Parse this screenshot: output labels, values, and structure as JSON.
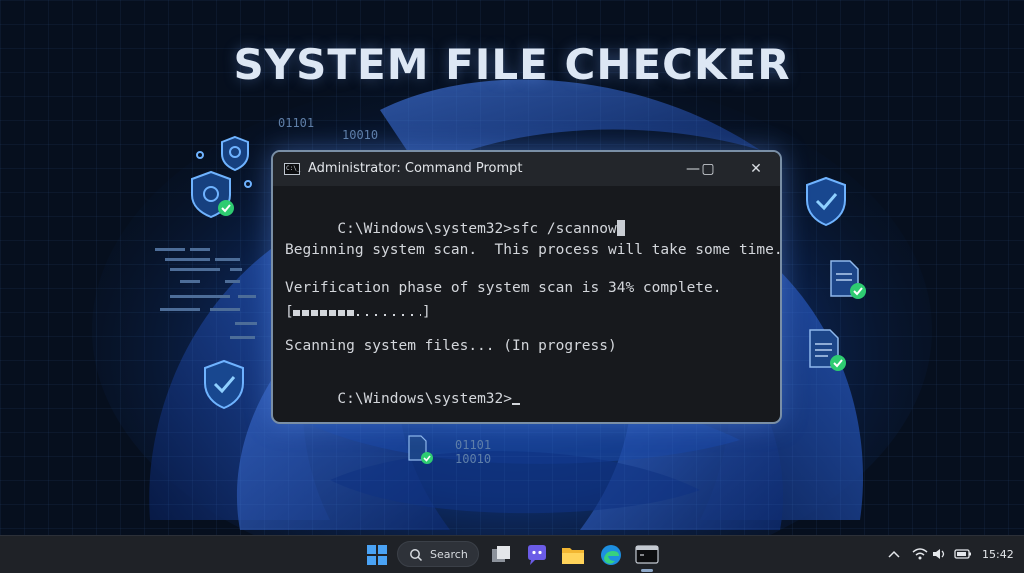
{
  "headline": "SYSTEM FILE CHECKER",
  "background_text": {
    "binary_left_1": "01101",
    "binary_left_2": "10010",
    "binary_bottom_1": "01101",
    "binary_bottom_2": "10010"
  },
  "window": {
    "title": "Administrator: Command Prompt",
    "icon_glyph": "C:\\_",
    "minimize_glyph": "—",
    "maximize_glyph": "▢",
    "close_glyph": "✕"
  },
  "terminal": {
    "command_prompt": "C:\\Windows\\system32>",
    "command": "sfc /scannow",
    "line_begin": "Beginning system scan.  This process will take some time.",
    "line_verification": "Verification phase of system scan is 34% complete.",
    "progress_fraction": 0.34,
    "progress_open": "[",
    "progress_close": "]",
    "line_scanning": "Scanning system files... (In progress)",
    "final_prompt": "C:\\Windows\\system32>"
  },
  "taskbar": {
    "search_label": "Search",
    "clock": "15:42",
    "apps": [
      "start-icon",
      "search-icon",
      "task-view-icon",
      "chat-icon",
      "file-explorer-icon",
      "edge-icon",
      "terminal-icon"
    ],
    "tray": [
      "chevron-up-icon",
      "wifi-icon",
      "speaker-icon",
      "battery-icon"
    ]
  },
  "colors": {
    "accent_blue": "#2f7fe0",
    "shield_blue": "#1c6fd8",
    "check_green": "#2ecc71",
    "terminal_bg": "#17191d"
  }
}
